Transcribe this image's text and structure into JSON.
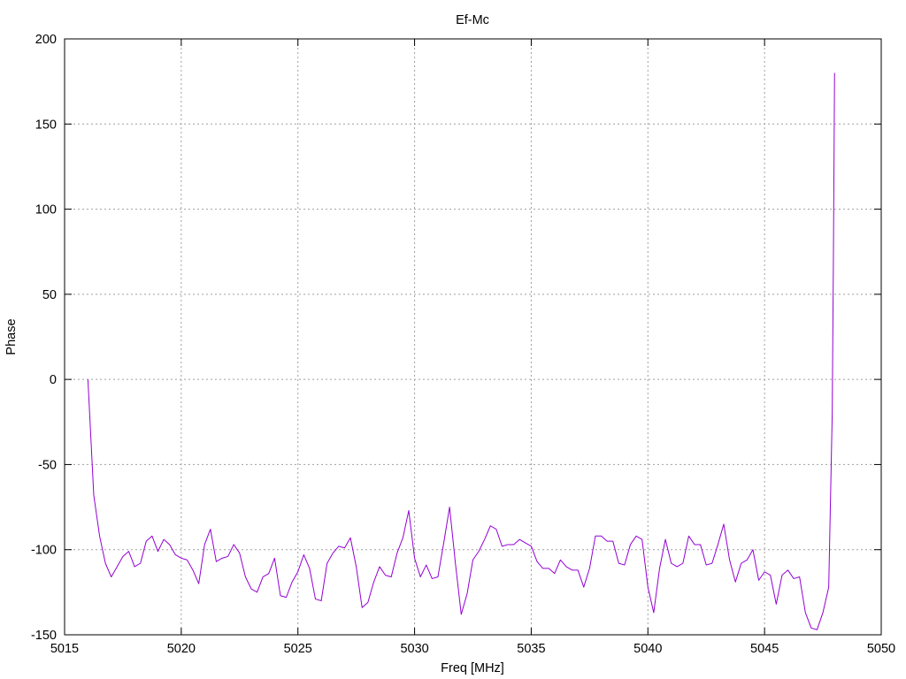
{
  "chart_data": {
    "type": "line",
    "title": "Ef-Mc",
    "xlabel": "Freq [MHz]",
    "ylabel": "Phase",
    "xlim": [
      5015,
      5050
    ],
    "ylim": [
      -150,
      200
    ],
    "xticks": [
      5015,
      5020,
      5025,
      5030,
      5035,
      5040,
      5045,
      5050
    ],
    "yticks": [
      -150,
      -100,
      -50,
      0,
      50,
      100,
      150,
      200
    ],
    "grid": true,
    "color": "#9400d3",
    "series": [
      {
        "name": "",
        "x": [
          5016.0,
          5016.25,
          5016.5,
          5016.75,
          5017.0,
          5017.25,
          5017.5,
          5017.75,
          5018.0,
          5018.25,
          5018.5,
          5018.75,
          5019.0,
          5019.25,
          5019.5,
          5019.75,
          5020.0,
          5020.25,
          5020.5,
          5020.75,
          5021.0,
          5021.25,
          5021.5,
          5021.75,
          5022.0,
          5022.25,
          5022.5,
          5022.75,
          5023.0,
          5023.25,
          5023.5,
          5023.75,
          5024.0,
          5024.25,
          5024.5,
          5024.75,
          5025.0,
          5025.25,
          5025.5,
          5025.75,
          5026.0,
          5026.25,
          5026.5,
          5026.75,
          5027.0,
          5027.25,
          5027.5,
          5027.75,
          5028.0,
          5028.25,
          5028.5,
          5028.75,
          5029.0,
          5029.25,
          5029.5,
          5029.75,
          5030.0,
          5030.25,
          5030.5,
          5030.75,
          5031.0,
          5031.25,
          5031.5,
          5031.75,
          5032.0,
          5032.25,
          5032.5,
          5032.75,
          5033.0,
          5033.25,
          5033.5,
          5033.75,
          5034.0,
          5034.25,
          5034.5,
          5034.75,
          5035.0,
          5035.25,
          5035.5,
          5035.75,
          5036.0,
          5036.25,
          5036.5,
          5036.75,
          5037.0,
          5037.25,
          5037.5,
          5037.75,
          5038.0,
          5038.25,
          5038.5,
          5038.75,
          5039.0,
          5039.25,
          5039.5,
          5039.75,
          5040.0,
          5040.25,
          5040.5,
          5040.75,
          5041.0,
          5041.25,
          5041.5,
          5041.75,
          5042.0,
          5042.25,
          5042.5,
          5042.75,
          5043.0,
          5043.25,
          5043.5,
          5043.75,
          5044.0,
          5044.25,
          5044.5,
          5044.75,
          5045.0,
          5045.25,
          5045.5,
          5045.75,
          5046.0,
          5046.25,
          5046.5,
          5046.75,
          5047.0,
          5047.25,
          5047.5,
          5047.75,
          5047.9,
          5047.95,
          5048.0
        ],
        "y": [
          0,
          -68,
          -92,
          -108,
          -116,
          -110,
          -104,
          -101,
          -110,
          -108,
          -95,
          -92,
          -101,
          -94,
          -97,
          -103,
          -105,
          -106,
          -112,
          -120,
          -97,
          -88,
          -107,
          -105,
          -104,
          -97,
          -102,
          -116,
          -123,
          -125,
          -116,
          -114,
          -105,
          -127,
          -128,
          -119,
          -113,
          -103,
          -111,
          -129,
          -130,
          -108,
          -102,
          -98,
          -99,
          -93,
          -110,
          -134,
          -131,
          -119,
          -110,
          -115,
          -116,
          -102,
          -93,
          -77,
          -105,
          -116,
          -109,
          -117,
          -116,
          -96,
          -75,
          -108,
          -138,
          -126,
          -106,
          -101,
          -94,
          -86,
          -88,
          -98,
          -97,
          -97,
          -94,
          -96,
          -98,
          -107,
          -111,
          -111,
          -114,
          -106,
          -110,
          -112,
          -112,
          -122,
          -111,
          -92,
          -92,
          -95,
          -95,
          -108,
          -109,
          -97,
          -92,
          -94,
          -122,
          -137,
          -111,
          -94,
          -108,
          -110,
          -108,
          -92,
          -97,
          -97,
          -109,
          -108,
          -97,
          -85,
          -106,
          -119,
          -108,
          -106,
          -100,
          -118,
          -113,
          -115,
          -132,
          -115,
          -112,
          -117,
          -116,
          -137,
          -146,
          -147,
          -137,
          -122,
          -20,
          70,
          180
        ]
      }
    ]
  }
}
